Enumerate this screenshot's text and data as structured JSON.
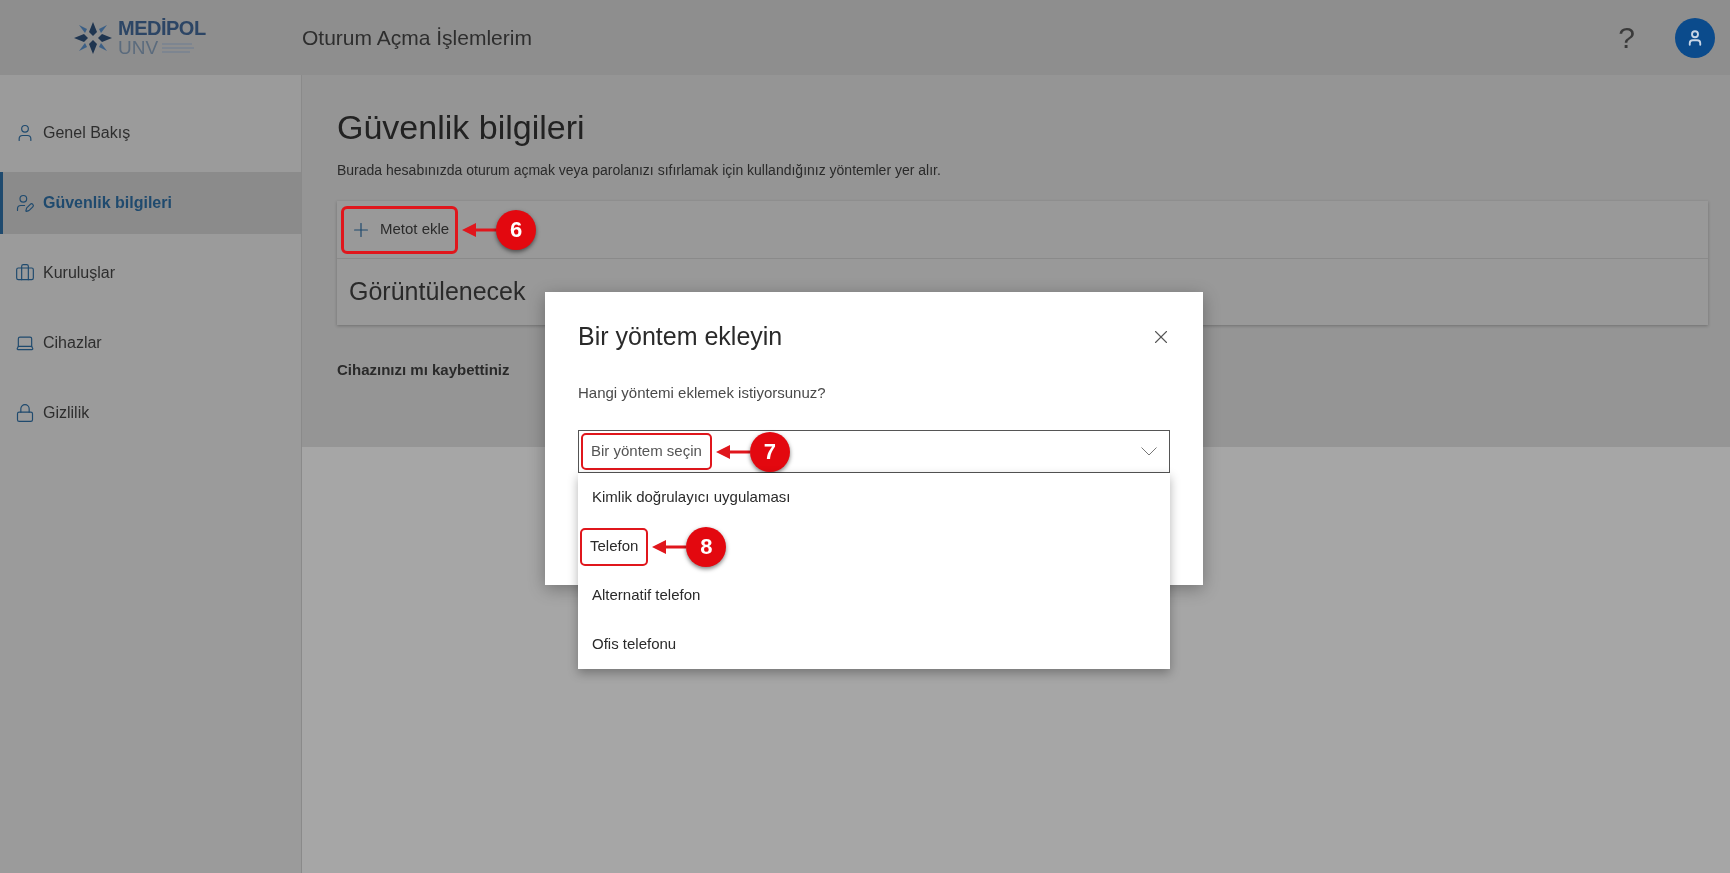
{
  "header": {
    "logo": {
      "name": "MEDİPOL",
      "subname": "UNV"
    },
    "title": "Oturum Açma İşlemlerim",
    "help": "?"
  },
  "sidebar": {
    "items": [
      {
        "label": "Genel Bakış",
        "kind": "person",
        "selected": false
      },
      {
        "label": "Güvenlik bilgileri",
        "kind": "security",
        "selected": true
      },
      {
        "label": "Kuruluşlar",
        "kind": "briefcase",
        "selected": false
      },
      {
        "label": "Cihazlar",
        "kind": "laptop",
        "selected": false
      },
      {
        "label": "Gizlilik",
        "kind": "lock",
        "selected": false
      }
    ]
  },
  "page": {
    "title": "Güvenlik bilgileri",
    "description": "Burada hesabınızda oturum açmak veya parolanızı sıfırlamak için kullandığınız yöntemler yer alır.",
    "add_method": {
      "label": "Metot ekle",
      "callout": "6"
    },
    "empty_text": "Görüntülenecek",
    "lost_device": "Cihazınızı mı kaybettiniz"
  },
  "dialog": {
    "title": "Bir yöntem ekleyin",
    "question": "Hangi yöntemi eklemek istiyorsunuz?",
    "select": {
      "placeholder": "Bir yöntem seçin",
      "callout": "7",
      "expanded": true
    },
    "options": [
      {
        "label": "Kimlik doğrulayıcı uygulaması",
        "selected": false
      },
      {
        "label": "Telefon",
        "selected": false,
        "callout": "8"
      },
      {
        "label": "Alternatif telefon",
        "selected": false
      },
      {
        "label": "Ofis telefonu",
        "selected": false
      }
    ]
  }
}
